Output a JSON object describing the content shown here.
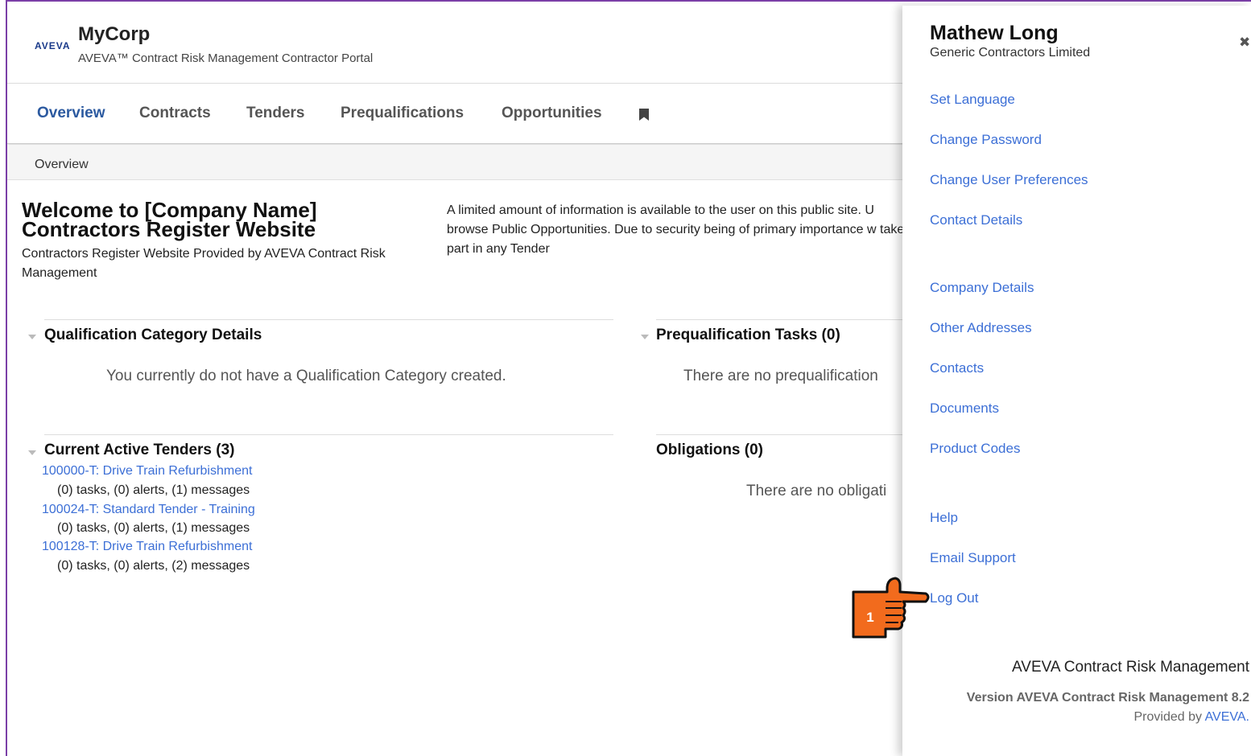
{
  "header": {
    "logo_text": "AVEVA",
    "company": "MyCorp",
    "portal_title": "AVEVA™ Contract Risk Management Contractor Portal"
  },
  "nav": {
    "items": [
      {
        "label": "Overview",
        "active": true
      },
      {
        "label": "Contracts",
        "active": false
      },
      {
        "label": "Tenders",
        "active": false
      },
      {
        "label": "Prequalifications",
        "active": false
      },
      {
        "label": "Opportunities",
        "active": false
      }
    ],
    "bookmark_icon": "bookmark-icon"
  },
  "breadcrumb": "Overview",
  "welcome": {
    "title_line1": "Welcome to [Company Name]",
    "title_line2": "Contractors Register Website",
    "subtitle": "Contractors Register Website Provided by AVEVA Contract Risk Management",
    "info": "A limited amount of information is available to the user on this public site. U browse Public Opportunities. Due to security being of primary importance w take part in any Tender"
  },
  "sections": {
    "qualification": {
      "heading": "Qualification Category Details",
      "empty": "You currently do not have a Qualification Category created."
    },
    "prequal_tasks": {
      "heading": "Prequalification Tasks (0)",
      "empty": "There are no prequalification"
    },
    "tenders": {
      "heading": "Current Active Tenders (3)",
      "items": [
        {
          "link": "100000-T: Drive Train Refurbishment",
          "meta": "(0) tasks, (0) alerts, (1) messages"
        },
        {
          "link": "100024-T: Standard Tender - Training",
          "meta": "(0) tasks, (0) alerts, (1) messages"
        },
        {
          "link": "100128-T: Drive Train Refurbishment",
          "meta": "(0) tasks, (0) alerts, (2) messages"
        }
      ]
    },
    "obligations": {
      "heading": "Obligations (0)",
      "empty": "There are no obligati"
    }
  },
  "panel": {
    "user_name": "Mathew Long",
    "user_company": "Generic Contractors Limited",
    "close_symbol": "✖",
    "menu": [
      "Set Language",
      "Change Password",
      "Change User Preferences",
      "Contact Details",
      "Company Details",
      "Other Addresses",
      "Contacts",
      "Documents",
      "Product Codes",
      "Help",
      "Email Support",
      "Log Out"
    ],
    "footer_title": "AVEVA Contract Risk Management",
    "footer_version": "Version AVEVA Contract Risk Management 8.2",
    "footer_provided_prefix": "Provided by ",
    "footer_provided_brand": "AVEVA."
  },
  "callout": {
    "step_number": "1",
    "color": "#f26b1d"
  },
  "colors": {
    "accent": "#2c5aa0",
    "link": "#3c6fd6",
    "frame": "#7b3fa7"
  }
}
